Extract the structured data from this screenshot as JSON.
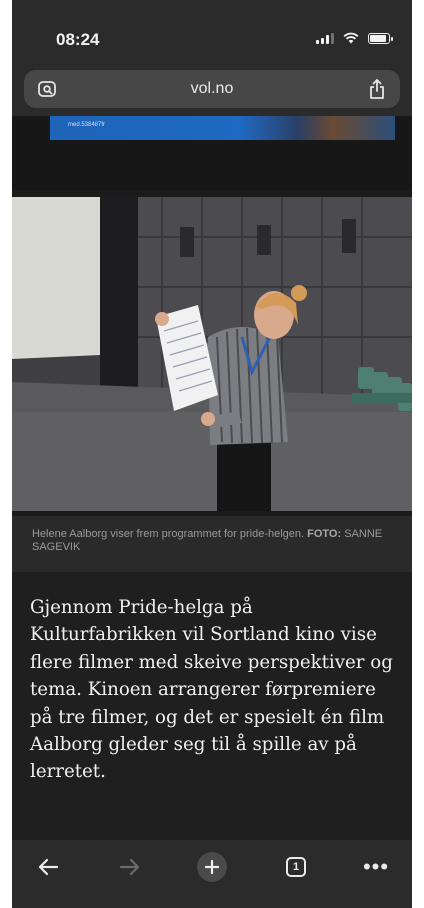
{
  "status_bar": {
    "time": "08:24"
  },
  "browser": {
    "url": "vol.no",
    "tabs_count": "1"
  },
  "ad": {
    "text": "med.538487fr"
  },
  "photo": {
    "alt": "Helene Aalborg viser frem programmet for pride-helgen i kinosalen"
  },
  "caption": {
    "text": "Helene Aalborg viser frem programmet for pride-helgen.",
    "credit_label": "FOTO:",
    "credit_name": "SANNE SAGEVIK"
  },
  "article": {
    "body": "Gjennom Pride-helga på Kulturfabrikken vil Sortland kino vise flere filmer med skeive perspektiver og tema. Kinoen arrangerer førpremiere på tre filmer, og det er spesielt én film Aalborg gleder seg til å spille av på lerretet."
  },
  "toolbar": {
    "icons": [
      "back-icon",
      "forward-icon",
      "new-tab-icon",
      "tabs-icon",
      "more-icon"
    ]
  },
  "colors": {
    "page_bg": "#1f1f1f",
    "chrome_bg": "#2b2b2b",
    "urlbar_bg": "#474747",
    "ad_blue": "#1e64b8"
  }
}
